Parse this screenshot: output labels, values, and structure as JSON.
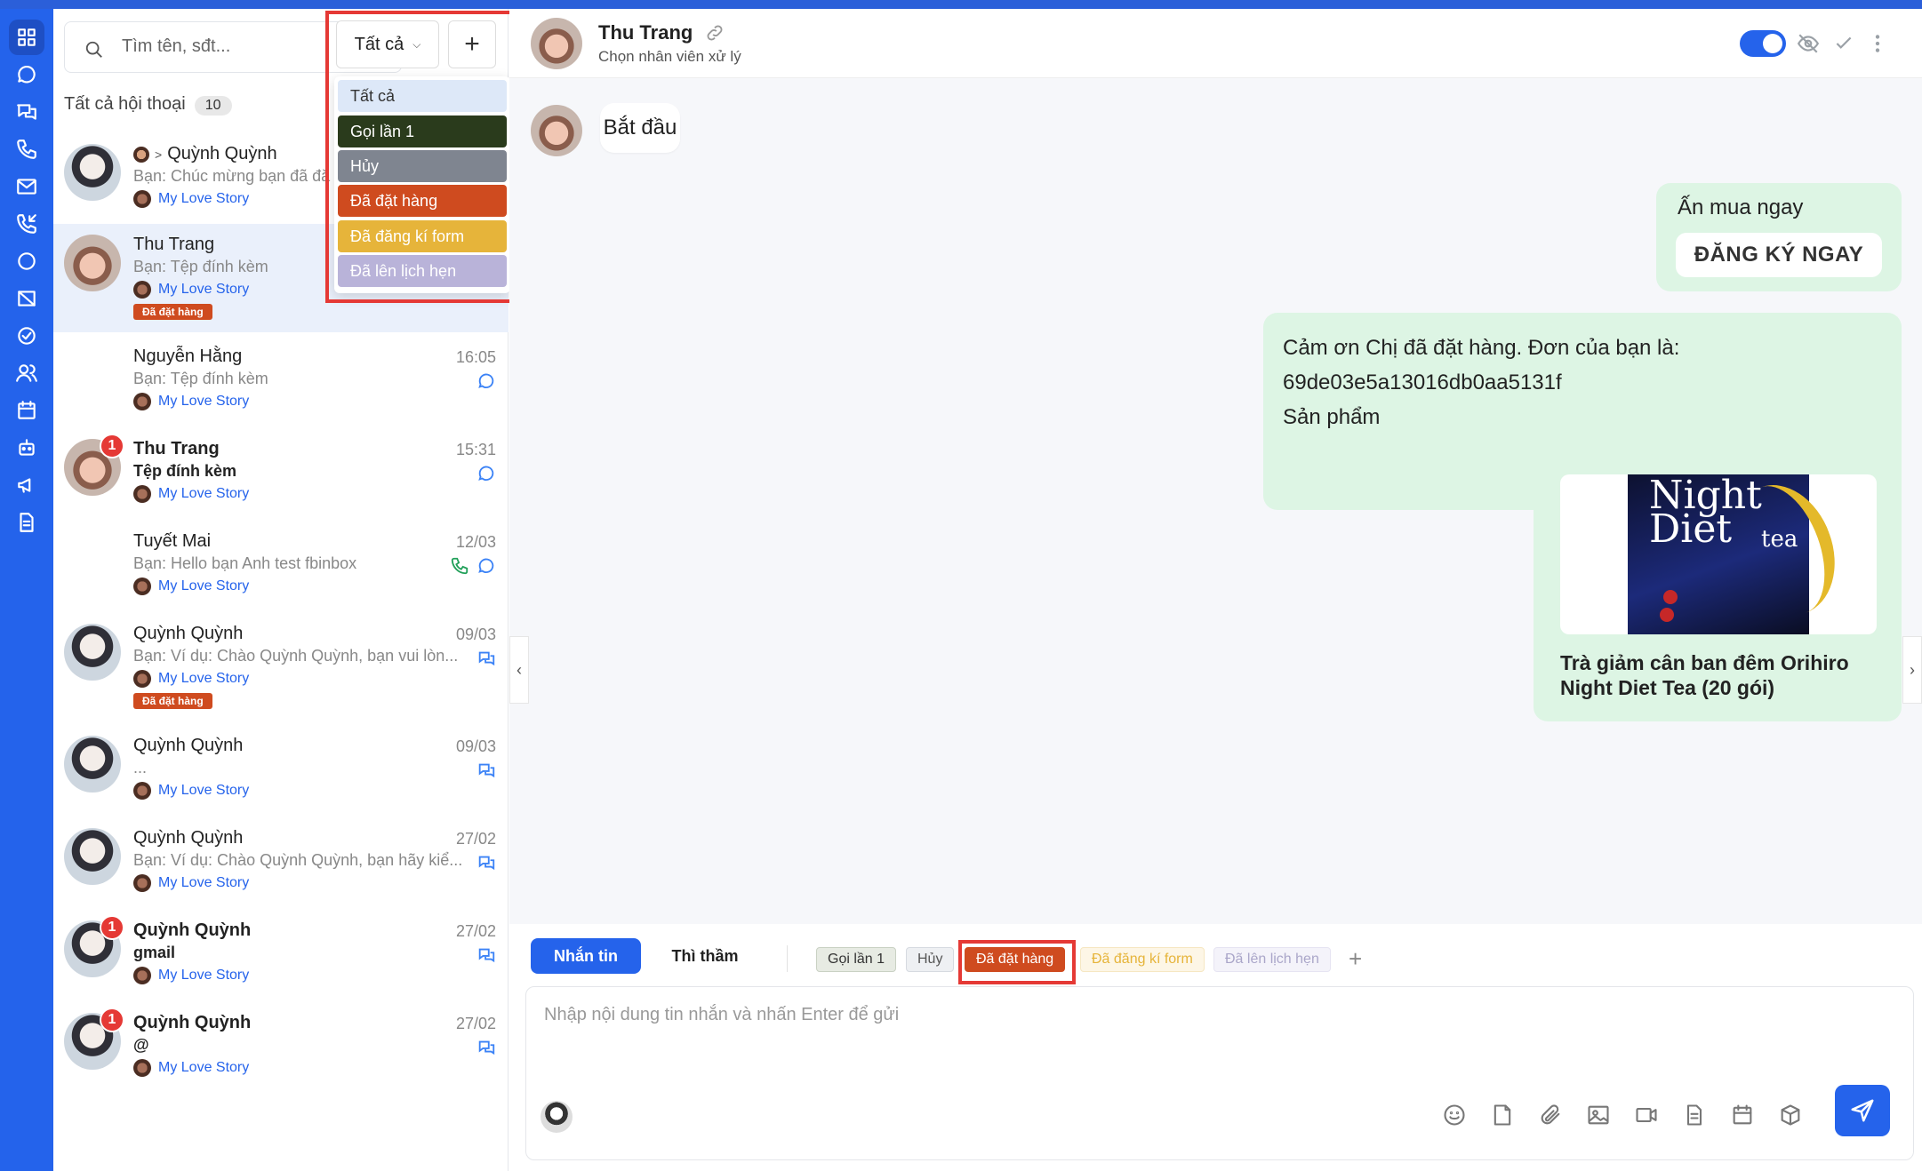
{
  "sidebar_icons": [
    "grid-icon",
    "chat-icon",
    "messages-icon",
    "phone-icon",
    "mail-icon",
    "call-log-icon",
    "circle-icon",
    "tag-icon",
    "check-circle-icon",
    "users-icon",
    "calendar-icon",
    "bot-icon",
    "megaphone-icon",
    "document-icon"
  ],
  "search": {
    "placeholder": "Tìm tên, sđt..."
  },
  "summary": {
    "label": "Tất cả hội thoại",
    "count": "10"
  },
  "filter": {
    "selected": "Tất cả",
    "add": "+",
    "options": [
      {
        "label": "Tất cả",
        "bg": "#dde8f8",
        "fg": "#333333"
      },
      {
        "label": "Gọi lần 1",
        "bg": "#2a3b1c",
        "fg": "#ffffff"
      },
      {
        "label": "Hủy",
        "bg": "#7f8590",
        "fg": "#ffffff"
      },
      {
        "label": "Đã đặt hàng",
        "bg": "#cf4b1f",
        "fg": "#ffffff"
      },
      {
        "label": "Đã đăng kí form",
        "bg": "#e6b43a",
        "fg": "#ffffff"
      },
      {
        "label": "Đã lên lịch hẹn",
        "bg": "#b9b3d9",
        "fg": "#ffffff"
      }
    ]
  },
  "conversations": [
    {
      "name": "Quỳnh Quỳnh",
      "preview": "Bạn: Chúc mừng bạn đã đă",
      "page": "My Love Story"
    },
    {
      "name": "Thu Trang",
      "preview": "Bạn: Tệp đính kèm",
      "page": "My Love Story",
      "tag": "Đã đặt hàng"
    },
    {
      "name": "Nguyễn Hằng",
      "preview": "Bạn: Tệp đính kèm",
      "page": "My Love Story",
      "time": "16:05"
    },
    {
      "name": "Thu Trang",
      "preview": "Tệp đính kèm",
      "page": "My Love Story",
      "time": "15:31",
      "badge": "1"
    },
    {
      "name": "Tuyết Mai",
      "preview": "Bạn: Hello bạn Anh test fbinbox",
      "page": "My Love Story",
      "time": "12/03"
    },
    {
      "name": "Quỳnh Quỳnh",
      "preview": "Bạn: Ví dụ: Chào Quỳnh Quỳnh, bạn vui lòn...",
      "page": "My Love Story",
      "time": "09/03",
      "tag": "Đã đặt hàng"
    },
    {
      "name": "Quỳnh Quỳnh",
      "preview": "...",
      "page": "My Love Story",
      "time": "09/03"
    },
    {
      "name": "Quỳnh Quỳnh",
      "preview": "Bạn: Ví dụ: Chào Quỳnh Quỳnh, bạn hãy kiể...",
      "page": "My Love Story",
      "time": "27/02"
    },
    {
      "name": "Quỳnh Quỳnh",
      "preview": "gmail",
      "page": "My Love Story",
      "time": "27/02",
      "badge": "1"
    },
    {
      "name": "Quỳnh Quỳnh",
      "preview": "@",
      "page": "My Love Story",
      "time": "27/02",
      "badge": "1"
    }
  ],
  "chat": {
    "contact_name": "Thu Trang",
    "assign_hint": "Chọn nhân viên xử lý",
    "messages": {
      "start": "Bắt đầu",
      "cta_text": "Ấn mua ngay",
      "cta_button": "ĐĂNG KÝ NGAY",
      "order_line1": "Cảm ơn Chị đã đặt hàng. Đơn của bạn là:",
      "order_line2": "69de03e5a13016db0aa5131f",
      "order_line3": "Sản phẩm",
      "product_image_text_1": "Night",
      "product_image_text_2": "Diet",
      "product_image_text_3": "tea",
      "product_title": "Trà giảm cân ban đêm Orihiro Night Diet Tea (20 gói)"
    }
  },
  "compose": {
    "tab_message": "Nhắn tin",
    "tab_whisper": "Thì thầm",
    "tags": [
      {
        "label": "Gọi lần 1",
        "bg": "#e7ebe3",
        "fg": "#333333",
        "border": "#c9d1c3"
      },
      {
        "label": "Hủy",
        "bg": "#eef0f3",
        "fg": "#555555",
        "border": "#d6dae0"
      },
      {
        "label": "Đã đặt hàng",
        "bg": "#cf4b1f",
        "fg": "#ffffff",
        "border": "#cf4b1f"
      },
      {
        "label": "Đã đăng kí form",
        "bg": "#fdf6e6",
        "fg": "#e6b43a",
        "border": "#f6e7c2"
      },
      {
        "label": "Đã lên lịch hẹn",
        "bg": "#f4f3fa",
        "fg": "#aaa6c9",
        "border": "#e6e4f2"
      }
    ],
    "add_tag": "+",
    "placeholder": "Nhập nội dung tin nhắn và nhấn Enter để gửi"
  },
  "colors": {
    "primary": "#2563eb",
    "tag_ordered": "#cf4b1f",
    "highlight_box": "#e53935"
  }
}
